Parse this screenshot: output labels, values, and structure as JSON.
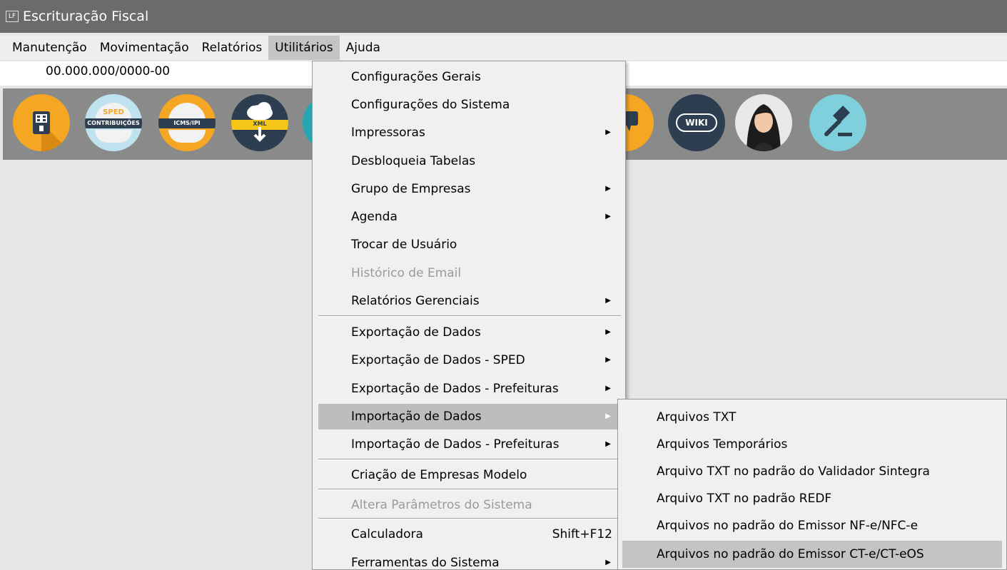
{
  "window": {
    "icon_text": "LF",
    "title": "Escrituração Fiscal"
  },
  "menubar": {
    "items": [
      "Manutenção",
      "Movimentação",
      "Relatórios",
      "Utilitários",
      "Ajuda"
    ]
  },
  "company": {
    "cnpj": "00.000.000/0000-00"
  },
  "toolbar": {
    "icons": [
      {
        "name": "company-building-icon"
      },
      {
        "name": "sped-contribuicoes-icon",
        "top": "SPED",
        "stripe": "CONTRIBUIÇÕES"
      },
      {
        "name": "sped-icms-ipi-icon",
        "stripe": "ICMS/IPI"
      },
      {
        "name": "xml-download-icon",
        "stripe": "XML"
      },
      {
        "name": "chat-icon"
      },
      {
        "name": "wiki-icon",
        "label": "WIKI"
      },
      {
        "name": "assistant-avatar-icon"
      },
      {
        "name": "legal-gavel-icon"
      }
    ]
  },
  "utilitarios_menu": {
    "items": [
      {
        "label": "Configurações Gerais"
      },
      {
        "label": "Configurações do Sistema"
      },
      {
        "label": "Impressoras",
        "submenu": true
      },
      {
        "label": "Desbloqueia Tabelas"
      },
      {
        "label": "Grupo de Empresas",
        "submenu": true
      },
      {
        "label": "Agenda",
        "submenu": true
      },
      {
        "label": "Trocar de Usuário"
      },
      {
        "label": "Histórico de Email",
        "disabled": true
      },
      {
        "label": "Relatórios Gerenciais",
        "submenu": true
      },
      {
        "label": "Exportação de Dados",
        "submenu": true
      },
      {
        "label": "Exportação de Dados - SPED",
        "submenu": true
      },
      {
        "label": "Exportação de Dados - Prefeituras",
        "submenu": true
      },
      {
        "label": "Importação de Dados",
        "submenu": true,
        "highlighted": true
      },
      {
        "label": "Importação de Dados - Prefeituras",
        "submenu": true
      },
      {
        "label": "Criação de Empresas Modelo"
      },
      {
        "label": "Altera Parâmetros do Sistema",
        "disabled": true
      },
      {
        "label": "Calculadora",
        "shortcut": "Shift+F12"
      },
      {
        "label": "Ferramentas do Sistema",
        "submenu": true
      }
    ]
  },
  "importacao_submenu": {
    "items": [
      {
        "label": "Arquivos TXT"
      },
      {
        "label": "Arquivos Temporários"
      },
      {
        "label": "Arquivo TXT no padrão do Validador Sintegra"
      },
      {
        "label": "Arquivo TXT no padrão REDF"
      },
      {
        "label": "Arquivos no padrão do Emissor NF-e/NFC-e"
      },
      {
        "label": "Arquivos no padrão do Emissor CT-e/CT-eOS",
        "highlighted": true
      }
    ]
  },
  "colors": {
    "titlebar": "#6b6b6b",
    "toolbar": "#8a8a8a",
    "menu_bg": "#f0f0f0",
    "highlight": "#bdbdbd",
    "disabled_text": "#9a9a9a"
  }
}
